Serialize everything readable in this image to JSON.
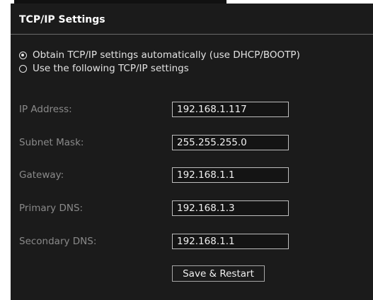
{
  "panel": {
    "title": "TCP/IP Settings"
  },
  "mode": {
    "options": [
      {
        "label": "Obtain TCP/IP settings automatically (use DHCP/BOOTP)",
        "selected": true
      },
      {
        "label": "Use the following TCP/IP settings",
        "selected": false
      }
    ]
  },
  "fields": [
    {
      "label": "IP Address:",
      "value": "192.168.1.117"
    },
    {
      "label": "Subnet Mask:",
      "value": "255.255.255.0"
    },
    {
      "label": "Gateway:",
      "value": "192.168.1.1"
    },
    {
      "label": "Primary DNS:",
      "value": "192.168.1.3"
    },
    {
      "label": "Secondary DNS:",
      "value": "192.168.1.1"
    }
  ],
  "actions": {
    "save_label": "Save & Restart"
  },
  "colors": {
    "panel_background": "#1b1b1b",
    "label_text": "#8a8a8a",
    "input_border": "#bdbdbd"
  }
}
